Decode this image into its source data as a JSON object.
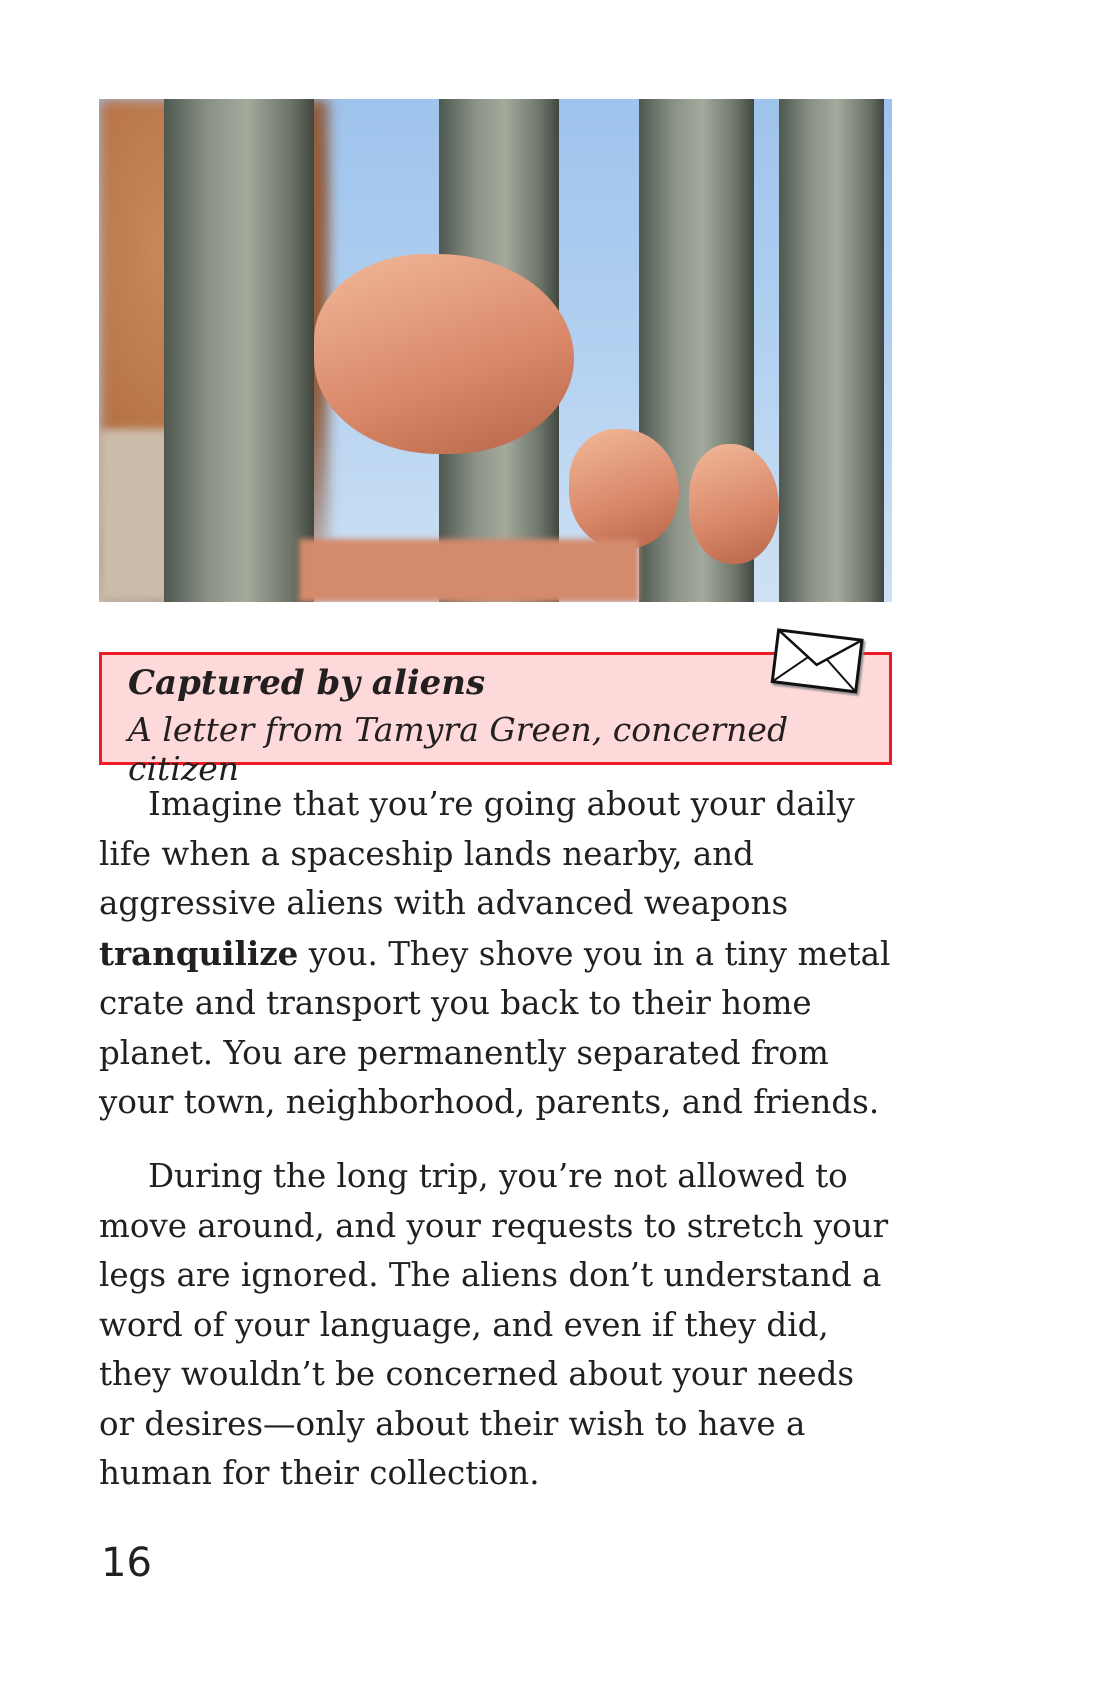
{
  "photo": {
    "description_icon": "child-hands-on-bars-photo"
  },
  "callout": {
    "title": "Captured by aliens",
    "subtitle": "A letter from Tamyra Green, concerned citizen",
    "icon": "envelope-icon",
    "border_color": "#ed1c24",
    "background_color": "#fdd9d9"
  },
  "paragraphs": [
    {
      "before": "Imagine that you’re going about your daily life when a spaceship lands nearby, and aggressive aliens with advanced weapons ",
      "bold": "tranquilize",
      "after": " you. They shove you in a tiny metal crate and transport you back to their home planet. You are permanently separated from your town, neighborhood, parents, and friends."
    },
    {
      "text": "During the long trip, you’re not allowed to move around, and your requests to stretch your legs are ignored. The aliens don’t understand a word of your language, and even if they did, they wouldn’t be concerned about your needs or desires—only about their wish to have a human for their collection."
    }
  ],
  "page_number": "16"
}
